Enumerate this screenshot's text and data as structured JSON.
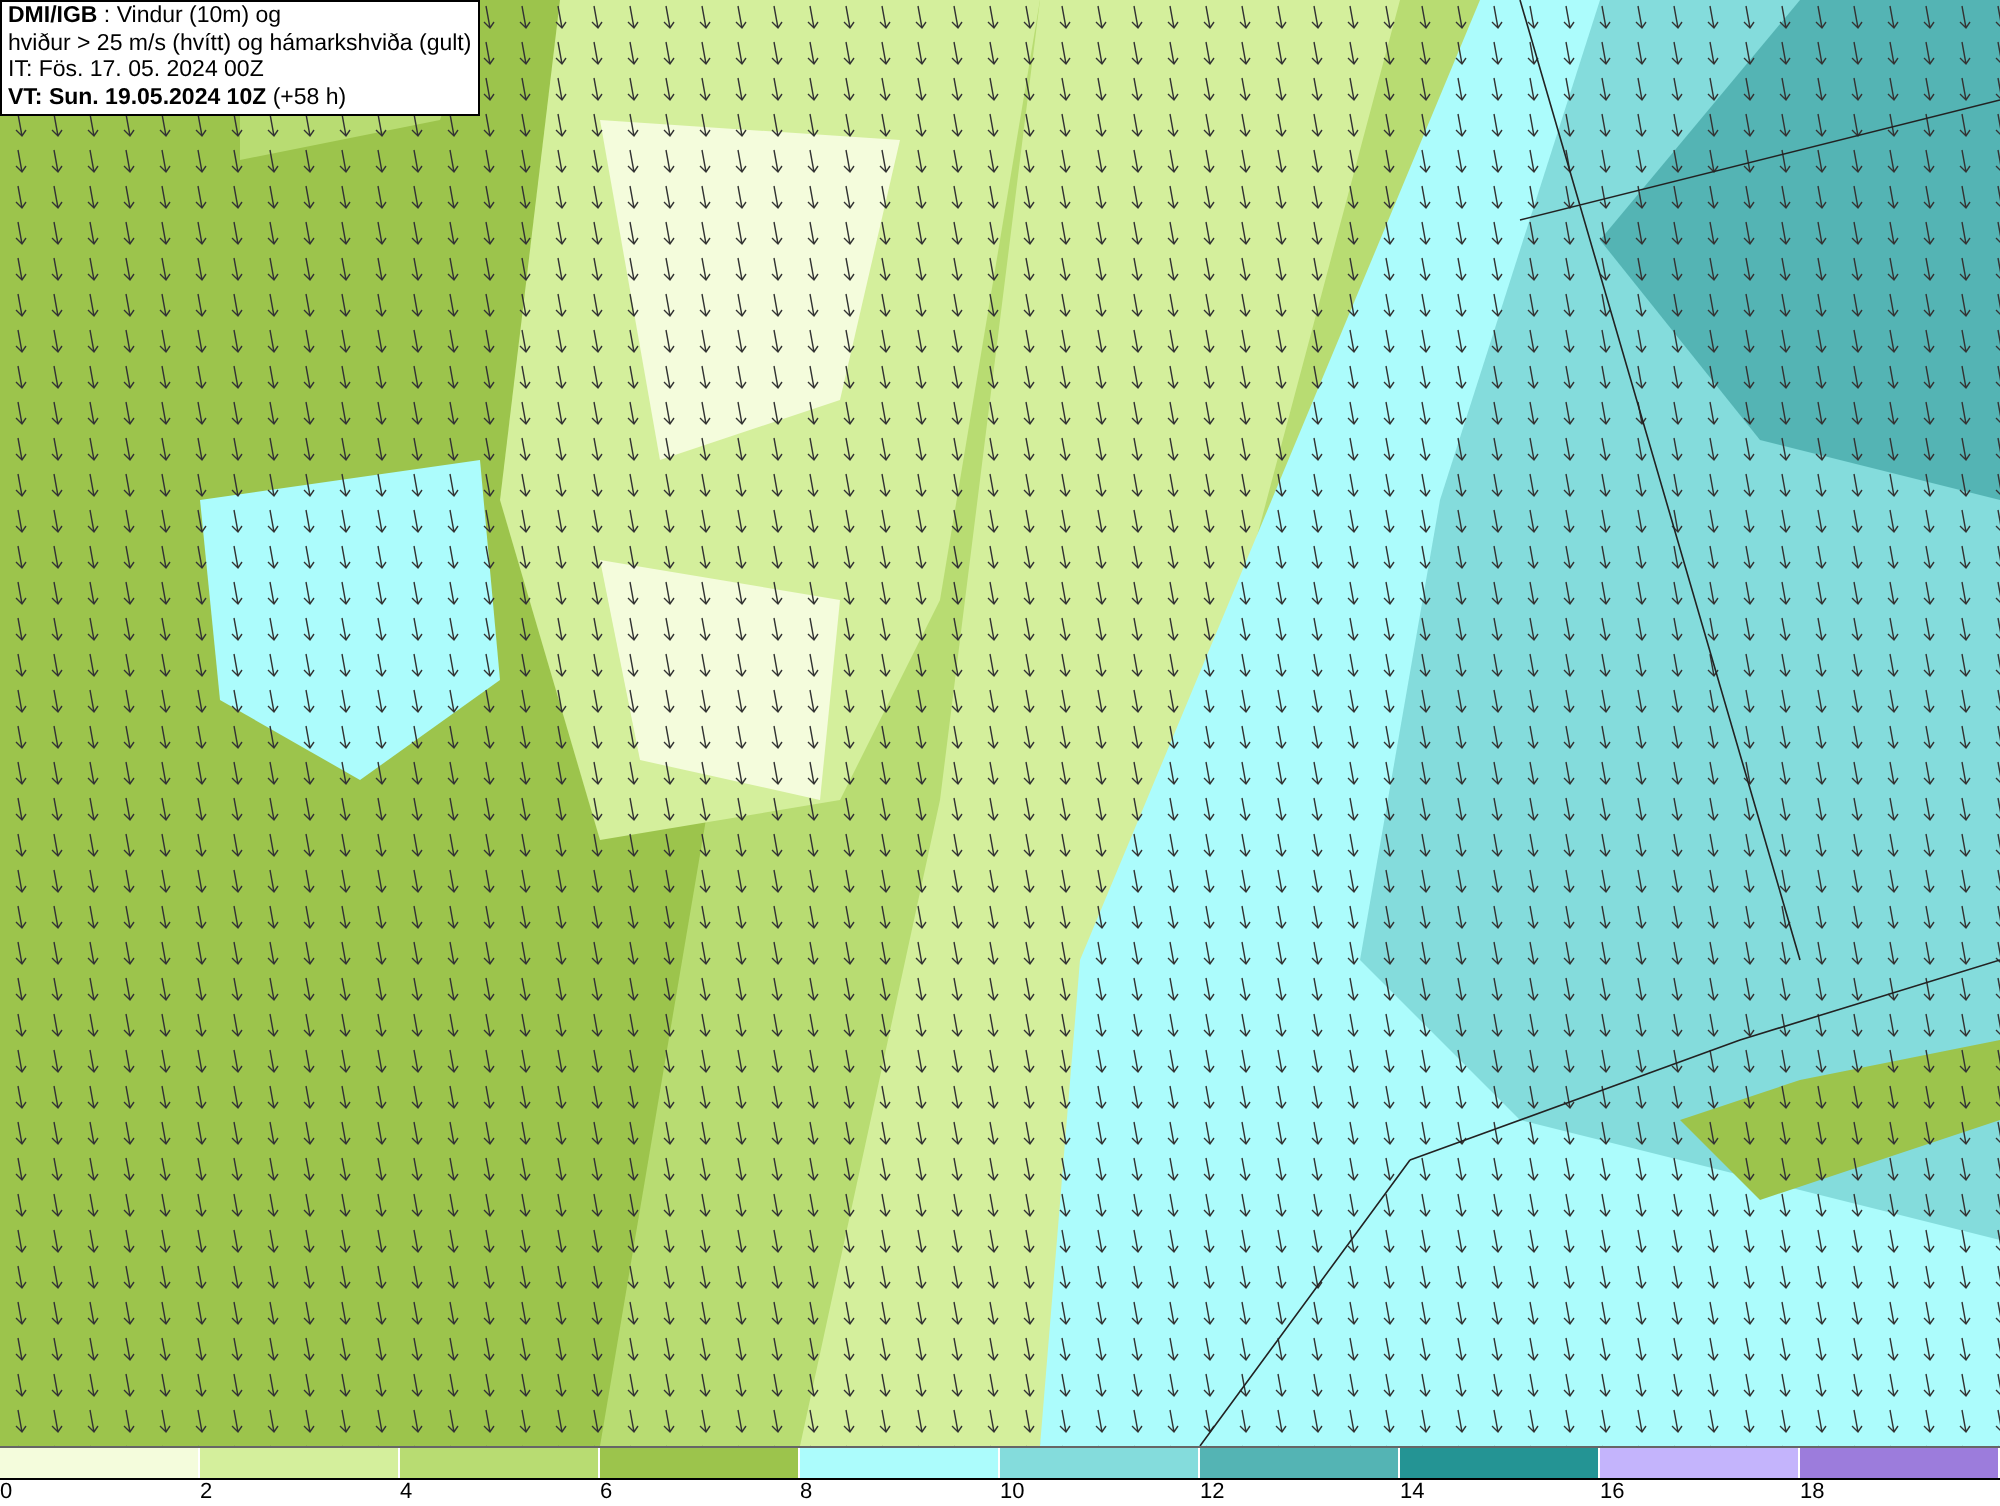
{
  "info_box": {
    "lines": [
      "**DMI/IGB** : Vindur (10m) og",
      "hviður > 25 m/s (hvítt) og hámarkshviða (gult)",
      "IT: Fös. 17. 05. 2024 00Z",
      "**VT: Sun. 19.05.2024 10Z** (+58 h)"
    ]
  },
  "legend": {
    "bins": [
      {
        "color": "#f4fcdc"
      },
      {
        "color": "#d4ef9c"
      },
      {
        "color": "#b8dc72"
      },
      {
        "color": "#9cc44c"
      },
      {
        "color": "#acfcfc"
      },
      {
        "color": "#84dcdc"
      },
      {
        "color": "#54b4b4"
      },
      {
        "color": "#249494"
      },
      {
        "color": "#c4b4fc"
      },
      {
        "color": "#9c7cdc"
      }
    ],
    "ticks": [
      "0",
      "2",
      "4",
      "6",
      "8",
      "10",
      "12",
      "14",
      "16",
      "18"
    ]
  }
}
